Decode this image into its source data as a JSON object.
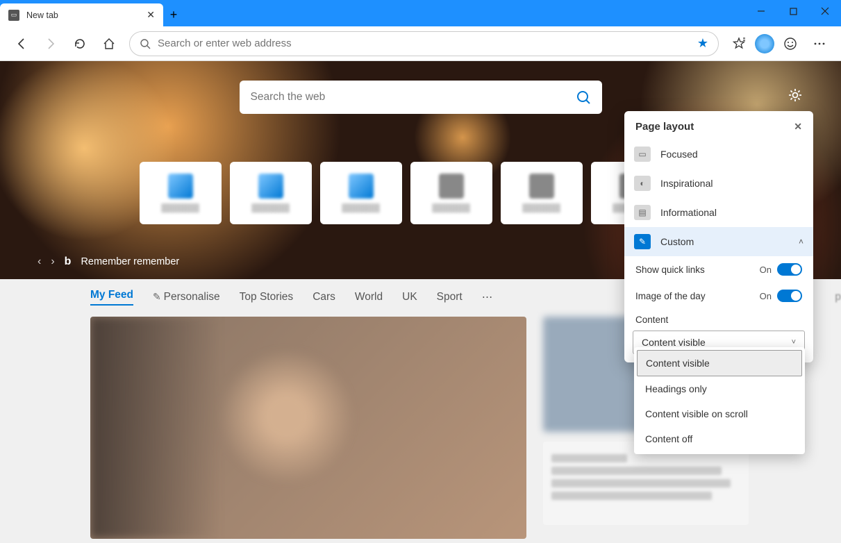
{
  "tab": {
    "title": "New tab"
  },
  "toolbar": {
    "address_placeholder": "Search or enter web address"
  },
  "hero": {
    "search_placeholder": "Search the web",
    "ticker": "Remember remember"
  },
  "feed": {
    "tabs": [
      "My Feed",
      "Personalise",
      "Top Stories",
      "Cars",
      "World",
      "UK",
      "Sport"
    ],
    "side_partial": "p"
  },
  "panel": {
    "title": "Page layout",
    "layouts": [
      {
        "label": "Focused"
      },
      {
        "label": "Inspirational"
      },
      {
        "label": "Informational"
      },
      {
        "label": "Custom"
      }
    ],
    "toggles": [
      {
        "label": "Show quick links",
        "state": "On"
      },
      {
        "label": "Image of the day",
        "state": "On"
      }
    ],
    "content_label": "Content",
    "content_selected": "Content visible",
    "content_options": [
      "Content visible",
      "Headings only",
      "Content visible on scroll",
      "Content off"
    ]
  }
}
